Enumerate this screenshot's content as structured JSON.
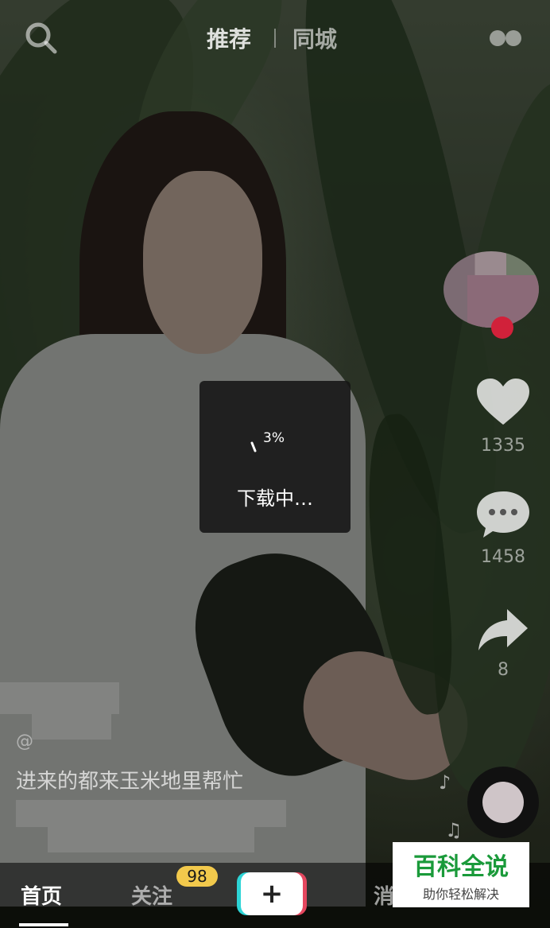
{
  "top_nav": {
    "tabs": [
      "推荐",
      "同城"
    ]
  },
  "actions": {
    "like_count": "1335",
    "comment_count": "1458",
    "share_count": "8"
  },
  "download": {
    "percent": "3%",
    "status": "下载中…"
  },
  "video": {
    "author": "@",
    "caption": "进来的都来玉米地里帮忙"
  },
  "bottom_nav": {
    "home": "首页",
    "follow": "关注",
    "follow_badge": "98",
    "plus": "+",
    "message": "消"
  },
  "watermark": {
    "title": "百科全说",
    "subtitle": "助你轻松解决"
  },
  "colors": {
    "like_red": "#d1213a",
    "badge_yellow": "#f2c94c",
    "watermark_green": "#1a9a3a"
  }
}
